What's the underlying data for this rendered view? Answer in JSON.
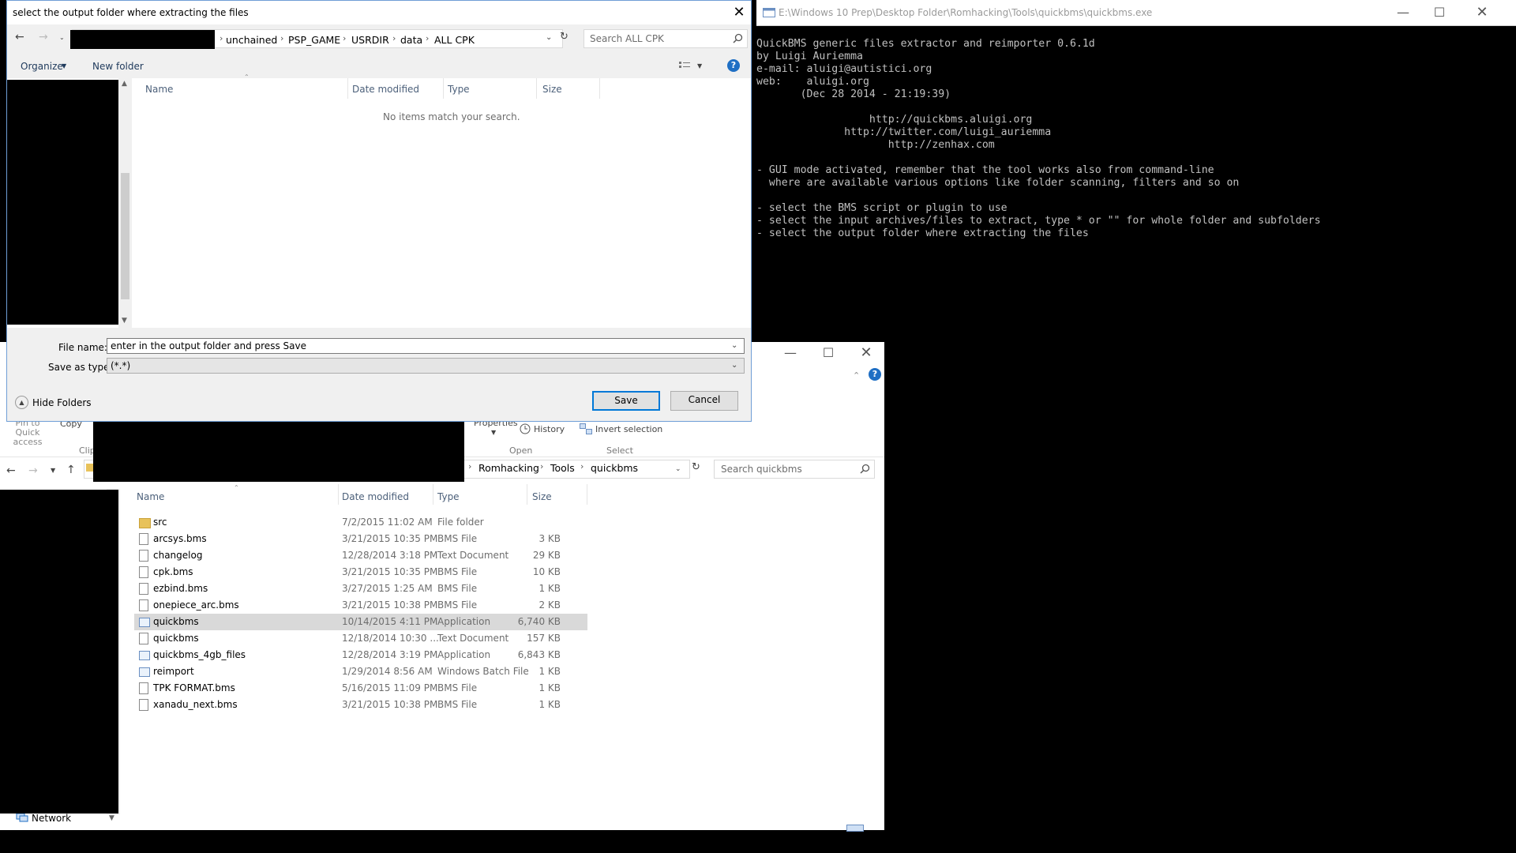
{
  "console": {
    "title": "E:\\Windows 10 Prep\\Desktop Folder\\Romhacking\\Tools\\quickbms\\quickbms.exe",
    "lines": [
      "QuickBMS generic files extractor and reimporter 0.6.1d",
      "by Luigi Auriemma",
      "e-mail: aluigi@autistici.org",
      "web:    aluigi.org",
      "       (Dec 28 2014 - 21:19:39)",
      "",
      "                  http://quickbms.aluigi.org",
      "              http://twitter.com/luigi_auriemma",
      "                     http://zenhax.com",
      "",
      "- GUI mode activated, remember that the tool works also from command-line",
      "  where are available various options like folder scanning, filters and so on",
      "",
      "- select the BMS script or plugin to use",
      "- select the input archives/files to extract, type * or \"\" for whole folder and subfolders",
      "- select the output folder where extracting the files"
    ]
  },
  "dialog": {
    "title": "select the output folder where extracting the files",
    "breadcrumb": [
      "unchained",
      "PSP_GAME",
      "USRDIR",
      "data",
      "ALL CPK"
    ],
    "search_placeholder": "Search ALL CPK",
    "organize_label": "Organize",
    "new_folder_label": "New folder",
    "columns": [
      "Name",
      "Date modified",
      "Type",
      "Size"
    ],
    "empty_message": "No items match your search.",
    "file_name_label": "File name:",
    "file_name_value": "enter in the output folder and press Save",
    "save_type_label": "Save as type:",
    "save_type_value": "(*.*)",
    "hide_folders_label": "Hide Folders",
    "save_label": "Save",
    "cancel_label": "Cancel"
  },
  "explorer": {
    "ribbon": {
      "pin_label": "Pin to Quick access",
      "copy_label": "Copy",
      "clipboard_group": "Clip",
      "properties_label": "Properties",
      "history_label": "History",
      "invert_label": "Invert selection",
      "open_group": "Open",
      "select_group": "Select"
    },
    "breadcrumb": [
      "Romhacking",
      "Tools",
      "quickbms"
    ],
    "search_placeholder": "Search quickbms",
    "columns": [
      "Name",
      "Date modified",
      "Type",
      "Size"
    ],
    "files": [
      {
        "name": "src",
        "date": "7/2/2015 11:02 AM",
        "type": "File folder",
        "size": "",
        "icon": "folder-icon"
      },
      {
        "name": "arcsys.bms",
        "date": "3/21/2015 10:35 PM",
        "type": "BMS File",
        "size": "3 KB",
        "icon": "file-icon"
      },
      {
        "name": "changelog",
        "date": "12/28/2014 3:18 PM",
        "type": "Text Document",
        "size": "29 KB",
        "icon": "file-icon"
      },
      {
        "name": "cpk.bms",
        "date": "3/21/2015 10:35 PM",
        "type": "BMS File",
        "size": "10 KB",
        "icon": "file-icon"
      },
      {
        "name": "ezbind.bms",
        "date": "3/27/2015 1:25 AM",
        "type": "BMS File",
        "size": "1 KB",
        "icon": "file-icon"
      },
      {
        "name": "onepiece_arc.bms",
        "date": "3/21/2015 10:38 PM",
        "type": "BMS File",
        "size": "2 KB",
        "icon": "file-icon"
      },
      {
        "name": "quickbms",
        "date": "10/14/2015 4:11 PM",
        "type": "Application",
        "size": "6,740 KB",
        "icon": "app-icon"
      },
      {
        "name": "quickbms",
        "date": "12/18/2014 10:30 ...",
        "type": "Text Document",
        "size": "157 KB",
        "icon": "file-icon"
      },
      {
        "name": "quickbms_4gb_files",
        "date": "12/28/2014 3:19 PM",
        "type": "Application",
        "size": "6,843 KB",
        "icon": "app-icon"
      },
      {
        "name": "reimport",
        "date": "1/29/2014 8:56 AM",
        "type": "Windows Batch File",
        "size": "1 KB",
        "icon": "batch-icon"
      },
      {
        "name": "TPK FORMAT.bms",
        "date": "5/16/2015 11:09 PM",
        "type": "BMS File",
        "size": "1 KB",
        "icon": "file-icon"
      },
      {
        "name": "xanadu_next.bms",
        "date": "3/21/2015 10:38 PM",
        "type": "BMS File",
        "size": "1 KB",
        "icon": "file-icon"
      }
    ],
    "nav_network_label": "Network"
  }
}
